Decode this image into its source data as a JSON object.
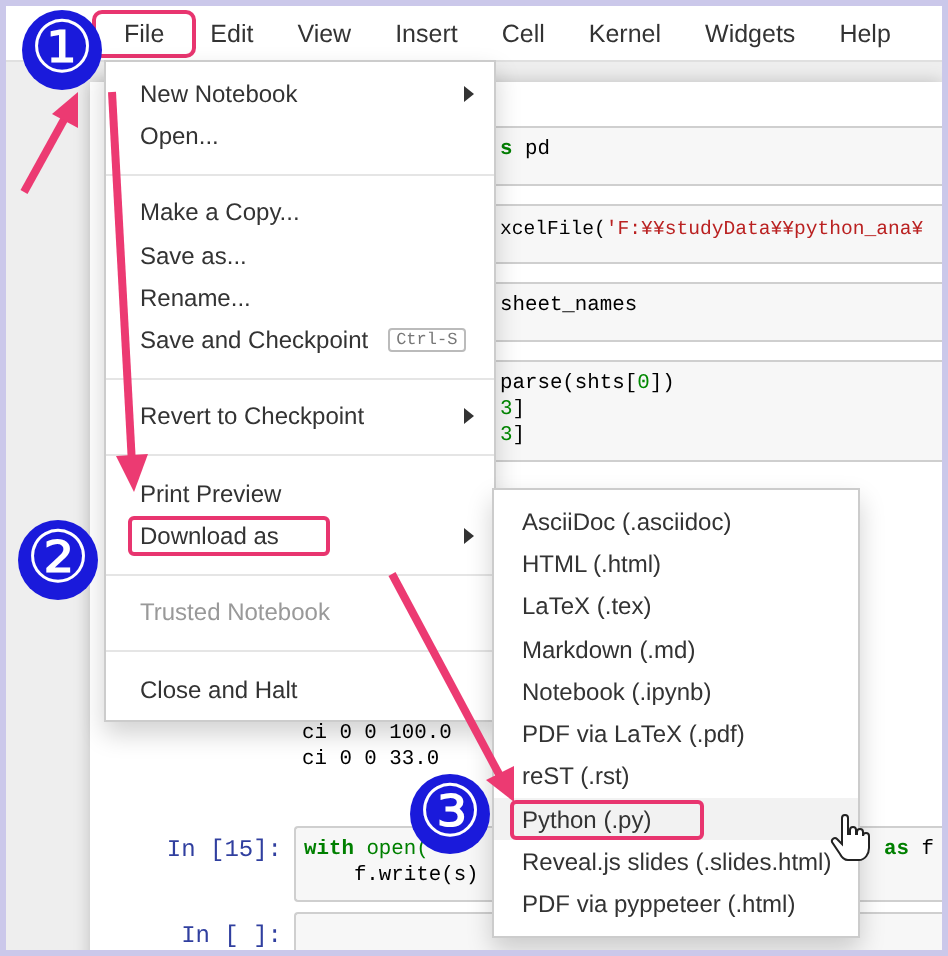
{
  "menu_bar": [
    {
      "label": "File",
      "highlighted": true
    },
    {
      "label": "Edit",
      "highlighted": false
    },
    {
      "label": "View",
      "highlighted": false
    },
    {
      "label": "Insert",
      "highlighted": false
    },
    {
      "label": "Cell",
      "highlighted": false
    },
    {
      "label": "Kernel",
      "highlighted": false
    },
    {
      "label": "Widgets",
      "highlighted": false
    },
    {
      "label": "Help",
      "highlighted": false
    }
  ],
  "file_menu": {
    "groups": [
      [
        {
          "label": "New Notebook",
          "has_submenu": true,
          "disabled": false,
          "highlighted": false
        },
        {
          "label": "Open...",
          "has_submenu": false,
          "disabled": false,
          "highlighted": false
        }
      ],
      [
        {
          "label": "Make a Copy...",
          "has_submenu": false,
          "disabled": false,
          "highlighted": false
        },
        {
          "label": "Save as...",
          "has_submenu": false,
          "disabled": false,
          "highlighted": false
        },
        {
          "label": "Rename...",
          "has_submenu": false,
          "disabled": false,
          "highlighted": false
        },
        {
          "label": "Save and Checkpoint",
          "shortcut": "Ctrl-S",
          "has_submenu": false,
          "disabled": false,
          "highlighted": false
        }
      ],
      [
        {
          "label": "Revert to Checkpoint",
          "has_submenu": true,
          "disabled": false,
          "highlighted": false
        }
      ],
      [
        {
          "label": "Print Preview",
          "has_submenu": false,
          "disabled": false,
          "highlighted": false
        },
        {
          "label": "Download as",
          "has_submenu": true,
          "disabled": false,
          "highlighted": true
        }
      ],
      [
        {
          "label": "Trusted Notebook",
          "has_submenu": false,
          "disabled": true,
          "highlighted": false
        }
      ],
      [
        {
          "label": "Close and Halt",
          "has_submenu": false,
          "disabled": false,
          "highlighted": false
        }
      ]
    ]
  },
  "download_submenu": [
    {
      "label": "AsciiDoc (.asciidoc)",
      "selected": false,
      "highlighted": false
    },
    {
      "label": "HTML (.html)",
      "selected": false,
      "highlighted": false
    },
    {
      "label": "LaTeX (.tex)",
      "selected": false,
      "highlighted": false
    },
    {
      "label": "Markdown (.md)",
      "selected": false,
      "highlighted": false
    },
    {
      "label": "Notebook (.ipynb)",
      "selected": false,
      "highlighted": false
    },
    {
      "label": "PDF via LaTeX (.pdf)",
      "selected": false,
      "highlighted": false
    },
    {
      "label": "reST (.rst)",
      "selected": false,
      "highlighted": false
    },
    {
      "label": "Python (.py)",
      "selected": true,
      "highlighted": true
    },
    {
      "label": "Reveal.js slides (.slides.html)",
      "selected": false,
      "highlighted": false
    },
    {
      "label": "PDF via pyppeteer (.html)",
      "selected": false,
      "highlighted": false
    }
  ],
  "cells": [
    {
      "kind": "code",
      "lines": [
        {
          "left": [
            {
              "kind": "kw",
              "text": "s"
            },
            {
              "kind": "plain",
              "text": " pd"
            }
          ]
        }
      ]
    },
    {
      "kind": "code",
      "lines": [
        {
          "left": [
            {
              "kind": "plain",
              "text": "xcelFile("
            },
            {
              "kind": "str",
              "text": "'F:¥¥studyData¥¥python_ana¥"
            }
          ]
        }
      ]
    },
    {
      "kind": "code",
      "lines": [
        {
          "left": [
            {
              "kind": "plain",
              "text": "sheet_names"
            }
          ]
        }
      ]
    },
    {
      "kind": "code",
      "lines": [
        {
          "left": [
            {
              "kind": "plain",
              "text": "parse(shts["
            },
            {
              "kind": "num",
              "text": "0"
            },
            {
              "kind": "plain",
              "text": "])"
            }
          ]
        },
        {
          "left": [
            {
              "kind": "num",
              "text": "3"
            },
            {
              "kind": "plain",
              "text": "]"
            }
          ]
        },
        {
          "left": [
            {
              "kind": "num",
              "text": "3"
            },
            {
              "kind": "plain",
              "text": "]"
            }
          ]
        }
      ]
    },
    {
      "kind": "output",
      "lines": [
        {
          "left": [
            {
              "kind": "plain",
              "text": "ci 0 0 100.0"
            }
          ]
        },
        {
          "left": [
            {
              "kind": "plain",
              "text": "ci 0 0 33.0"
            }
          ]
        }
      ]
    },
    {
      "kind": "code",
      "prompt": "In [15]:",
      "lines": [
        {
          "left": [
            {
              "kind": "kw",
              "text": "with"
            },
            {
              "kind": "builtin",
              "text": " open("
            }
          ],
          "right": [
            {
              "kind": "kw",
              "text": "as"
            },
            {
              "kind": "plain",
              "text": " f"
            }
          ]
        },
        {
          "left": [
            {
              "kind": "plain",
              "text": "    f.write(s)"
            }
          ]
        }
      ]
    },
    {
      "kind": "code",
      "prompt": "In [ ]:"
    }
  ],
  "callouts": [
    "①",
    "②",
    "③"
  ]
}
